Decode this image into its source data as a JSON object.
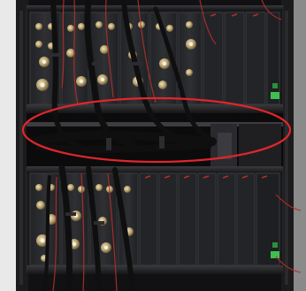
{
  "image": {
    "alt": "",
    "subject": "equipment-rack-photo"
  },
  "colors": {
    "rack_frame": "#1c1c1e",
    "module_face": "#2a2b2e",
    "module_edge": "#3a3b3f",
    "brass_connector": "#b8a270",
    "cable_black": "#0f0f10",
    "cable_red": "#b0302a",
    "highlight_ellipse": "#e0262b",
    "status_led_green": "#3fbf4f",
    "background_white": "#ffffff"
  },
  "annotation": {
    "shape": "ellipse",
    "color": "#e0262b"
  }
}
